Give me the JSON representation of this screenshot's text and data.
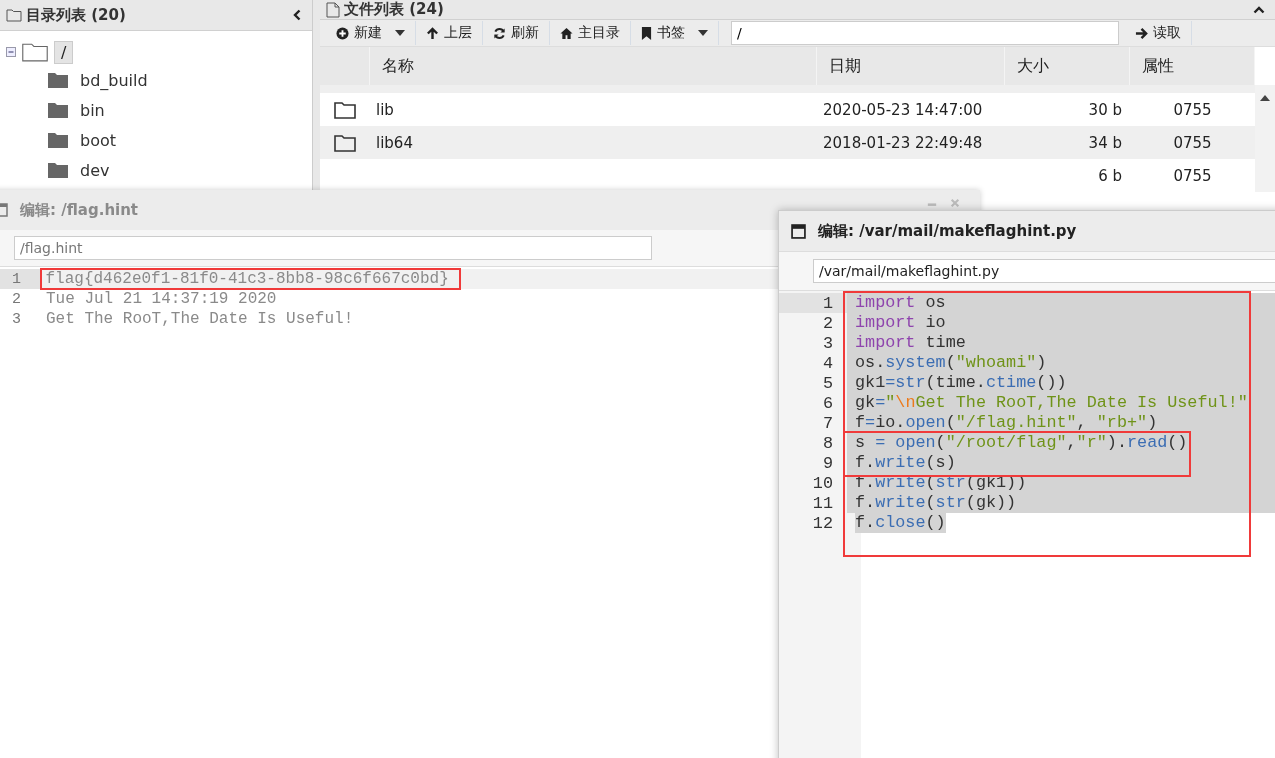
{
  "tree_panel": {
    "title": "目录列表 (20)",
    "root": {
      "label": "/",
      "selected": true,
      "expanded": true,
      "children": [
        {
          "label": "bd_build"
        },
        {
          "label": "bin"
        },
        {
          "label": "boot"
        },
        {
          "label": "dev"
        }
      ]
    }
  },
  "file_panel": {
    "title": "文件列表 (24)",
    "toolbar": [
      {
        "label": "新建",
        "dropdown": true
      },
      {
        "label": "上层",
        "dropdown": false
      },
      {
        "label": "刷新",
        "dropdown": false
      },
      {
        "label": "主目录",
        "dropdown": false
      },
      {
        "label": "书签",
        "dropdown": true
      }
    ],
    "path": "/",
    "read_button": "读取",
    "columns": [
      "名称",
      "日期",
      "大小",
      "属性"
    ],
    "rows": [
      {
        "name": "lib",
        "date": "2020-05-23 14:47:00",
        "size": "30 b",
        "attributes": "0755",
        "alt": false
      },
      {
        "name": "lib64",
        "date": "2018-01-23 22:49:48",
        "size": "34 b",
        "attributes": "0755",
        "alt": true
      },
      {
        "size": "6 b",
        "attributes": "0755",
        "alt": false
      }
    ]
  },
  "editors": [
    {
      "title": "编辑: /flag.hint",
      "path": "/flag.hint",
      "lines": [
        {
          "number": "1",
          "active": true,
          "tokens": [
            {
              "text": "flag{d462e0f1-81f0-41c3-8bb8-98c6f667c0bd}",
              "kind": "plain"
            }
          ]
        },
        {
          "number": "2",
          "active": false,
          "tokens": [
            {
              "text": "Tue Jul 21 14:37:19 2020",
              "kind": "plain"
            }
          ]
        },
        {
          "number": "3",
          "active": false,
          "tokens": [
            {
              "text": "Get The RooT,The Date Is Useful!",
              "kind": "plain"
            }
          ]
        }
      ]
    },
    {
      "title": "编辑: /var/mail/makeflaghint.py",
      "path": "/var/mail/makeflaghint.py",
      "lines": [
        {
          "number": "1",
          "active": true,
          "selected": true,
          "tokens": [
            {
              "text": "import",
              "kind": "keyword"
            },
            {
              "text": " os",
              "kind": "plain"
            }
          ]
        },
        {
          "number": "2",
          "active": false,
          "selected": true,
          "tokens": [
            {
              "text": "import",
              "kind": "keyword"
            },
            {
              "text": " io",
              "kind": "plain"
            }
          ]
        },
        {
          "number": "3",
          "active": false,
          "selected": true,
          "tokens": [
            {
              "text": "import",
              "kind": "keyword"
            },
            {
              "text": " time",
              "kind": "plain"
            }
          ]
        },
        {
          "number": "4",
          "active": false,
          "selected": true,
          "tokens": [
            {
              "text": "os.",
              "kind": "plain"
            },
            {
              "text": "system",
              "kind": "func"
            },
            {
              "text": "(",
              "kind": "plain"
            },
            {
              "text": "\"whoami\"",
              "kind": "string"
            },
            {
              "text": ")",
              "kind": "plain"
            }
          ]
        },
        {
          "number": "5",
          "active": false,
          "selected": true,
          "tokens": [
            {
              "text": "gk1",
              "kind": "plain"
            },
            {
              "text": "=str",
              "kind": "func"
            },
            {
              "text": "(time.",
              "kind": "plain"
            },
            {
              "text": "ctime",
              "kind": "func"
            },
            {
              "text": "())",
              "kind": "plain"
            }
          ]
        },
        {
          "number": "6",
          "active": false,
          "selected": true,
          "tokens": [
            {
              "text": "gk",
              "kind": "plain"
            },
            {
              "text": "=",
              "kind": "func"
            },
            {
              "text": "\"",
              "kind": "string"
            },
            {
              "text": "\\n",
              "kind": "escape"
            },
            {
              "text": "Get The RooT,The Date Is Useful!\"",
              "kind": "string"
            }
          ]
        },
        {
          "number": "7",
          "active": false,
          "selected": true,
          "tokens": [
            {
              "text": "f",
              "kind": "plain"
            },
            {
              "text": "=",
              "kind": "func"
            },
            {
              "text": "io.",
              "kind": "plain"
            },
            {
              "text": "open",
              "kind": "func"
            },
            {
              "text": "(",
              "kind": "plain"
            },
            {
              "text": "\"/flag.hint\"",
              "kind": "string"
            },
            {
              "text": ", ",
              "kind": "plain"
            },
            {
              "text": "\"rb+\"",
              "kind": "string"
            },
            {
              "text": ")",
              "kind": "plain"
            }
          ]
        },
        {
          "number": "8",
          "active": false,
          "selected": true,
          "tokens": [
            {
              "text": "s ",
              "kind": "plain"
            },
            {
              "text": "=",
              "kind": "func"
            },
            {
              "text": " open",
              "kind": "func"
            },
            {
              "text": "(",
              "kind": "plain"
            },
            {
              "text": "\"/root/flag\"",
              "kind": "string"
            },
            {
              "text": ",",
              "kind": "plain"
            },
            {
              "text": "\"r\"",
              "kind": "string"
            },
            {
              "text": ").",
              "kind": "plain"
            },
            {
              "text": "read",
              "kind": "func"
            },
            {
              "text": "()",
              "kind": "plain"
            }
          ]
        },
        {
          "number": "9",
          "active": false,
          "selected": true,
          "tokens": [
            {
              "text": "f.",
              "kind": "plain"
            },
            {
              "text": "write",
              "kind": "func"
            },
            {
              "text": "(s)",
              "kind": "plain"
            }
          ]
        },
        {
          "number": "10",
          "active": false,
          "selected": true,
          "tokens": [
            {
              "text": "f.",
              "kind": "plain"
            },
            {
              "text": "write",
              "kind": "func"
            },
            {
              "text": "(",
              "kind": "plain"
            },
            {
              "text": "str",
              "kind": "func"
            },
            {
              "text": "(gk1))",
              "kind": "plain"
            }
          ]
        },
        {
          "number": "11",
          "active": false,
          "selected": true,
          "tokens": [
            {
              "text": "f.",
              "kind": "plain"
            },
            {
              "text": "write",
              "kind": "func"
            },
            {
              "text": "(",
              "kind": "plain"
            },
            {
              "text": "str",
              "kind": "func"
            },
            {
              "text": "(gk))",
              "kind": "plain"
            }
          ]
        },
        {
          "number": "12",
          "active": false,
          "selected": true,
          "tokens": [
            {
              "text": "f.",
              "kind": "plain"
            },
            {
              "text": "close",
              "kind": "func"
            },
            {
              "text": "()",
              "kind": "plain"
            }
          ]
        }
      ]
    }
  ]
}
